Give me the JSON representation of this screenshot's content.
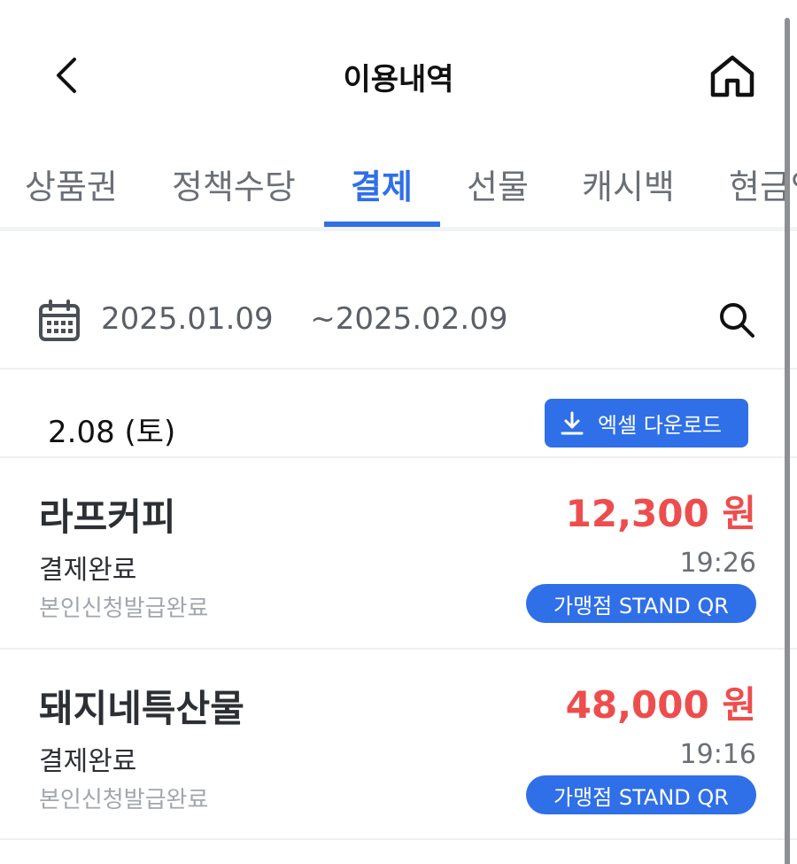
{
  "header": {
    "title": "이용내역",
    "back_icon": "chevron-left-icon",
    "home_icon": "home-icon"
  },
  "tabs": [
    {
      "label": "상품권",
      "active": false
    },
    {
      "label": "정책수당",
      "active": false
    },
    {
      "label": "결제",
      "active": true
    },
    {
      "label": "선물",
      "active": false
    },
    {
      "label": "캐시백",
      "active": false
    },
    {
      "label": "현금영",
      "active": false
    }
  ],
  "date_filter": {
    "start": "2025.01.09",
    "end": "~2025.02.09",
    "calendar_icon": "calendar-icon",
    "search_icon": "search-icon"
  },
  "section": {
    "day_label": "2.08 (토)",
    "excel_button": "엑셀 다운로드"
  },
  "transactions": [
    {
      "store": "라프커피",
      "amount": "12,300 원",
      "status": "결제완료",
      "time": "19:26",
      "sub": "본인신청발급완료",
      "badge": "가맹점 STAND QR"
    },
    {
      "store": "돼지네특산물",
      "amount": "48,000 원",
      "status": "결제완료",
      "time": "19:16",
      "sub": "본인신청발급완료",
      "badge": "가맹점 STAND QR"
    }
  ],
  "colors": {
    "accent": "#2f6fe8",
    "amount": "#ee4d4d"
  }
}
